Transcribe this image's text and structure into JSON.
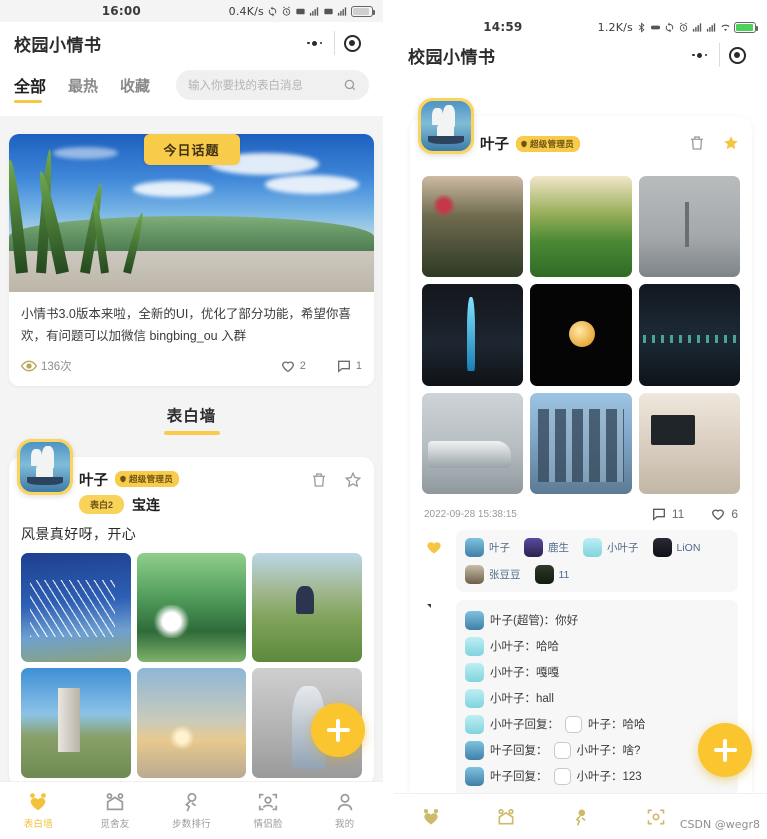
{
  "left": {
    "statusbar": {
      "time": "16:00",
      "speed": "0.4K/s",
      "icons": [
        "sync-icon",
        "alarm-icon",
        "sim-data-icon",
        "signal-1-icon",
        "sim-data-2-icon",
        "signal-2-icon",
        "battery-icon"
      ],
      "network_label_1": "5G",
      "network_label_2": "4G",
      "battery_color": "#ffffff"
    },
    "appbar": {
      "title": "校园小情书",
      "menu_icon": "more-dots-icon",
      "target_icon": "capsule-target-icon"
    },
    "tabs": [
      {
        "label": "全部",
        "active": true
      },
      {
        "label": "最热",
        "active": false
      },
      {
        "label": "收藏",
        "active": false
      }
    ],
    "search": {
      "placeholder": "输入你要找的表白消息",
      "value": "",
      "icon": "search-icon"
    },
    "topic": {
      "badge": "今日话题",
      "text": "小情书3.0版本来啦，全新的UI，优化了部分功能，希望你喜欢，有问题可以加微信 bingbing_ou 入群",
      "views": "136次",
      "views_icon": "eye-icon",
      "likes": "2",
      "like_icon": "heart-icon",
      "comments": "1",
      "comment_icon": "comment-icon"
    },
    "section": {
      "title": "表白墙"
    },
    "post": {
      "avatar": "sailing-ship-avatar",
      "username": "叶子",
      "admin_badge": "超级管理员",
      "type_badge": "表白2",
      "target_name": "宝连",
      "delete_icon": "trash-icon",
      "star_icon": "star-outline-icon",
      "content": "风景真好呀，开心",
      "images": [
        "bridge-photo",
        "flower-field-photo",
        "couple-field-photo",
        "monument-photo",
        "sunset-lake-photo",
        "person-wall-photo"
      ]
    },
    "fab": {
      "icon": "plus-icon",
      "color": "#fbc52f"
    },
    "bottomnav": [
      {
        "label": "表白墙",
        "icon": "heart-bear-icon",
        "active": true
      },
      {
        "label": "觅舍友",
        "icon": "house-bear-icon",
        "active": false
      },
      {
        "label": "步数排行",
        "icon": "run-bear-icon",
        "active": false
      },
      {
        "label": "情侣脸",
        "icon": "face-scan-icon",
        "active": false
      },
      {
        "label": "我的",
        "icon": "profile-bear-icon",
        "active": false
      }
    ]
  },
  "right": {
    "statusbar": {
      "time": "14:59",
      "speed": "1.2K/s",
      "icons": [
        "bluetooth-icon",
        "vpn-icon",
        "sync-icon",
        "alarm-icon",
        "signal-1-icon",
        "signal-2-icon",
        "wifi-icon",
        "battery-icon"
      ],
      "battery_color": "#4cd15a"
    },
    "appbar": {
      "title": "校园小情书",
      "menu_icon": "more-dots-icon",
      "target_icon": "capsule-target-icon"
    },
    "post": {
      "avatar": "sailing-ship-avatar",
      "username": "叶子",
      "admin_badge": "超级管理员",
      "delete_icon": "trash-icon",
      "star_icon": "star-filled-icon",
      "images": [
        "blossom-sunset-photo",
        "lawn-photo",
        "tv-tower-photo",
        "canton-tower-night-photo",
        "full-moon-photo",
        "river-night-photo",
        "navy-ship-photo",
        "city-towers-photo",
        "living-room-photo"
      ],
      "timestamp": "2022-09-28 15:38:15",
      "comment_count": "11",
      "comment_icon": "comment-icon",
      "like_count": "6",
      "like_icon": "heart-icon"
    },
    "likes": {
      "heart_icon": "heart-filled-icon",
      "users": [
        {
          "name": "叶子",
          "avatar": "av-ye"
        },
        {
          "name": "鹿生",
          "avatar": "av-ds"
        },
        {
          "name": "小叶子",
          "avatar": "av-xy"
        },
        {
          "name": "LiON",
          "avatar": "av-li"
        },
        {
          "name": "张豆豆",
          "avatar": "av-zd"
        },
        {
          "name": "11",
          "avatar": "av-bk"
        }
      ]
    },
    "comments": {
      "icon": "comment-bubble-icon",
      "items": [
        {
          "avatar": "av-ye",
          "text": "叶子(超管)：你好",
          "reply": false
        },
        {
          "avatar": "av-xy",
          "text": "小叶子：哈哈",
          "reply": false
        },
        {
          "avatar": "av-xy",
          "text": "小叶子：嘎嘎",
          "reply": false
        },
        {
          "avatar": "av-xy",
          "text": "小叶子：hall",
          "reply": false
        },
        {
          "avatar": "av-xy",
          "prefix": "小叶子回复：",
          "text": "叶子：哈哈",
          "reply": true
        },
        {
          "avatar": "av-ye",
          "prefix": "叶子回复：",
          "text": "小叶子：啥?",
          "reply": true
        },
        {
          "avatar": "av-ye",
          "prefix": "叶子回复：",
          "text": "小叶子：123",
          "reply": true
        }
      ]
    },
    "fab": {
      "icon": "plus-icon",
      "color": "#fbc52f"
    },
    "bottomnav": [
      {
        "label": "",
        "icon": "heart-bear-icon"
      },
      {
        "label": "",
        "icon": "house-bear-icon"
      },
      {
        "label": "",
        "icon": "run-bear-icon"
      },
      {
        "label": "",
        "icon": "face-scan-icon"
      }
    ],
    "watermark": "CSDN @wegr8"
  }
}
